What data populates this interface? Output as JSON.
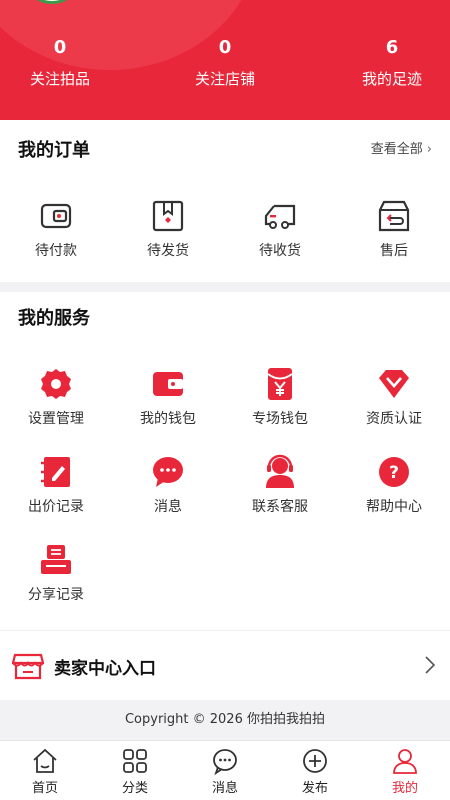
{
  "colors": {
    "brand": "#e8283a",
    "background": "#f2f2f4"
  },
  "header": {
    "stats": [
      {
        "value": "0",
        "label": "关注拍品"
      },
      {
        "value": "0",
        "label": "关注店铺"
      },
      {
        "value": "6",
        "label": "我的足迹"
      }
    ]
  },
  "orders": {
    "title": "我的订单",
    "view_all": "查看全部",
    "items": [
      {
        "label": "待付款",
        "icon": "wallet-icon"
      },
      {
        "label": "待发货",
        "icon": "package-icon"
      },
      {
        "label": "待收货",
        "icon": "truck-icon"
      },
      {
        "label": "售后",
        "icon": "return-box-icon"
      }
    ]
  },
  "services": {
    "title": "我的服务",
    "items": [
      {
        "label": "设置管理",
        "icon": "settings-icon"
      },
      {
        "label": "我的钱包",
        "icon": "wallet-icon"
      },
      {
        "label": "专场钱包",
        "icon": "yen-envelope-icon"
      },
      {
        "label": "资质认证",
        "icon": "diamond-icon"
      },
      {
        "label": "出价记录",
        "icon": "notebook-icon"
      },
      {
        "label": "消息",
        "icon": "chat-bubble-icon"
      },
      {
        "label": "联系客服",
        "icon": "customer-service-icon"
      },
      {
        "label": "帮助中心",
        "icon": "help-icon"
      },
      {
        "label": "分享记录",
        "icon": "printer-icon"
      }
    ]
  },
  "seller": {
    "label": "卖家中心入口",
    "icon": "store-icon"
  },
  "copyright": "Copyright © 2026 你拍拍我拍拍",
  "tabbar": {
    "active": "我的",
    "items": [
      {
        "label": "首页",
        "icon": "home-icon"
      },
      {
        "label": "分类",
        "icon": "grid-icon"
      },
      {
        "label": "消息",
        "icon": "message-icon"
      },
      {
        "label": "发布",
        "icon": "plus-circle-icon"
      },
      {
        "label": "我的",
        "icon": "person-icon"
      }
    ]
  }
}
